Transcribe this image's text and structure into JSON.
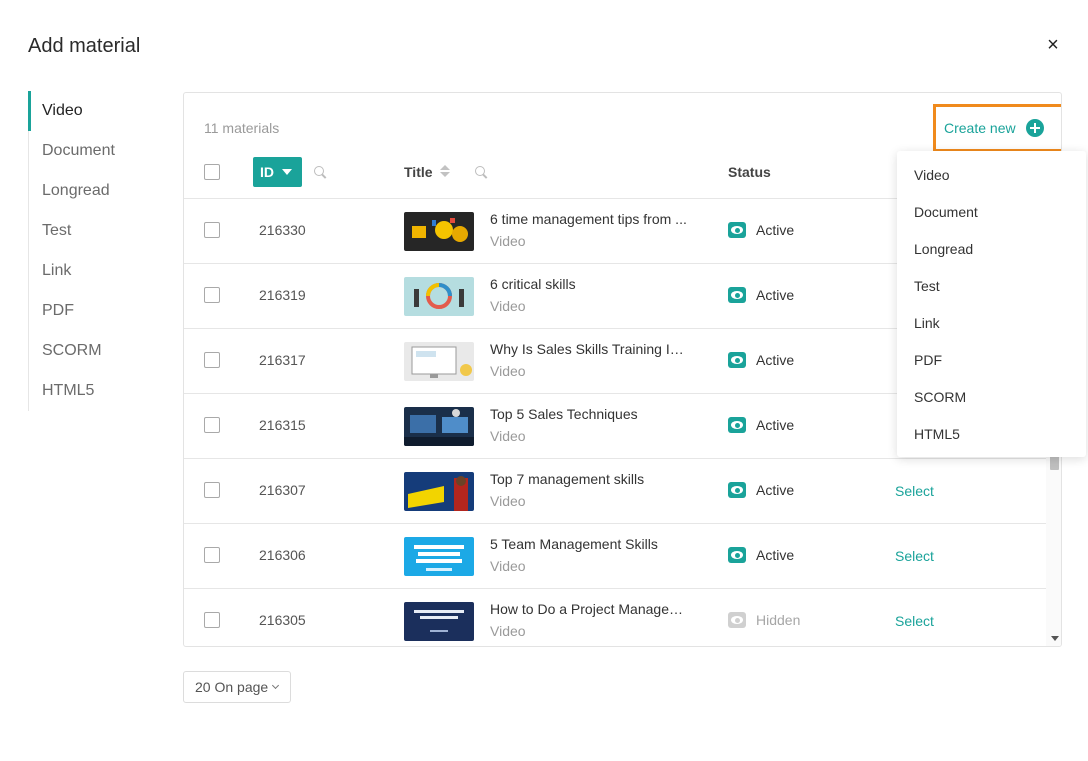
{
  "dialog": {
    "title": "Add material",
    "close_glyph": "×"
  },
  "sidebar": {
    "active": "Video",
    "items": [
      {
        "label": "Video"
      },
      {
        "label": "Document"
      },
      {
        "label": "Longread"
      },
      {
        "label": "Test"
      },
      {
        "label": "Link"
      },
      {
        "label": "PDF"
      },
      {
        "label": "SCORM"
      },
      {
        "label": "HTML5"
      }
    ]
  },
  "panel": {
    "count_label": "11 materials",
    "create_new_label": "Create new",
    "columns": {
      "id": "ID",
      "title": "Title",
      "status": "Status"
    },
    "rows": [
      {
        "id": "216330",
        "title": "6 time management tips from ...",
        "type": "Video",
        "status": "Active",
        "action": ""
      },
      {
        "id": "216319",
        "title": "6 critical skills",
        "type": "Video",
        "status": "Active",
        "action": ""
      },
      {
        "id": "216317",
        "title": "Why Is Sales Skills Training Im...",
        "type": "Video",
        "status": "Active",
        "action": ""
      },
      {
        "id": "216315",
        "title": "Top 5 Sales Techniques",
        "type": "Video",
        "status": "Active",
        "action": ""
      },
      {
        "id": "216307",
        "title": "Top 7 management skills",
        "type": "Video",
        "status": "Active",
        "action": "Select"
      },
      {
        "id": "216306",
        "title": "5 Team Management Skills",
        "type": "Video",
        "status": "Active",
        "action": "Select"
      },
      {
        "id": "216305",
        "title": "How to Do a Project Managem...",
        "type": "Video",
        "status": "Hidden",
        "action": "Select"
      }
    ]
  },
  "create_menu": {
    "items": [
      {
        "label": "Video"
      },
      {
        "label": "Document"
      },
      {
        "label": "Longread"
      },
      {
        "label": "Test"
      },
      {
        "label": "Link"
      },
      {
        "label": "PDF"
      },
      {
        "label": "SCORM"
      },
      {
        "label": "HTML5"
      }
    ]
  },
  "pagination": {
    "per_page_label": "20 On page"
  },
  "colors": {
    "accent": "#1aa39a",
    "highlight": "#f08a1c",
    "muted": "#9a9a9a"
  },
  "icons": {
    "close": "close-icon",
    "plus": "plus-circle-icon",
    "sort": "sort-icon",
    "search": "search-icon",
    "status_active": "eye-icon",
    "status_hidden": "eye-off-icon"
  }
}
